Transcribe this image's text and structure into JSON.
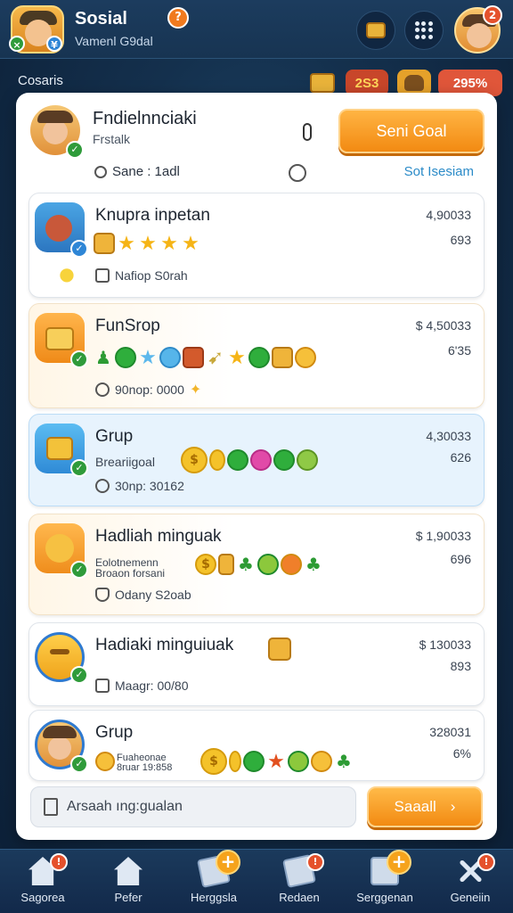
{
  "header": {
    "title": "Sosial",
    "subtitle": "Vamenl G9dal",
    "help_badge": "?",
    "user_badge": "2",
    "profile_badges": [
      "×",
      "¥"
    ]
  },
  "section_label": "Cosaris",
  "resources": {
    "coins": "2S3",
    "percent": "295%"
  },
  "panel_header": {
    "title": "Fndielnnciaki",
    "subtitle": "Frstalk",
    "button_label": "Seni Goal",
    "meta": "Sane : 1adl",
    "link": "Sot Isesiam"
  },
  "cards": [
    {
      "title": "Knupra inpetan",
      "number": "4,90033",
      "number2": "693",
      "meta": "Nafiop S0rah",
      "style": "plain",
      "icon_kind": "stars"
    },
    {
      "title": "FunSrop",
      "number": "$ 4,50033",
      "number2": "6'35",
      "meta": "90nop: 0000",
      "style": "warm",
      "icon_kind": "mixed"
    },
    {
      "title": "Grup",
      "sub": "Breariigoal",
      "number": "4,30033",
      "number2": "626",
      "meta": "30np: 30162",
      "style": "blue",
      "icon_kind": "coins"
    },
    {
      "title": "Hadliah minguak",
      "sub": "Eolotnemenn\nBroaon forsani",
      "number": "$ 1,90033",
      "number2": "696",
      "meta": "Odany S2oab",
      "style": "warm",
      "icon_kind": "trees"
    },
    {
      "title": "Hadiaki minguiuak",
      "number": "$ 130033",
      "number2": "893",
      "meta": "Maagr: 00/80",
      "style": "plain",
      "icon_kind": "none"
    },
    {
      "title": "Grup",
      "sub": "Fuaheonae\n8ruar 19:858",
      "number": "328031",
      "number2": "6%",
      "style": "plain",
      "icon_kind": "coins2"
    }
  ],
  "chat_input": {
    "placeholder": "Arsaah ıng:gualan"
  },
  "save_button": {
    "label": "Saaall",
    "arrow": "›"
  },
  "bottom_nav": [
    {
      "label": "Sagorea",
      "badge": "!"
    },
    {
      "label": "Pefer",
      "badge": ""
    },
    {
      "label": "Herggsla",
      "badge": "+"
    },
    {
      "label": "Redaen",
      "badge": "!"
    },
    {
      "label": "Serggenan",
      "badge": "+"
    },
    {
      "label": "Geneiin",
      "badge": "!"
    }
  ],
  "colors": {
    "accent": "#f28a12",
    "background": "#14304d",
    "link": "#2b8bc8",
    "check": "#2f9b3a"
  }
}
